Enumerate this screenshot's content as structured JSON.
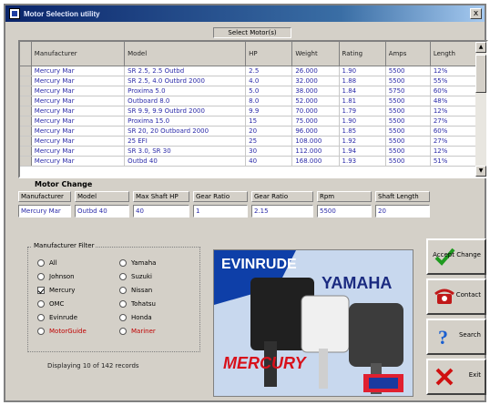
{
  "window": {
    "title": "Motor Selection utility",
    "close_glyph": "x"
  },
  "grid": {
    "caption": "Select Motor(s)",
    "columns": [
      "Manufacturer",
      "Model",
      "HP",
      "Weight",
      "Rating",
      "Amps",
      "Length"
    ],
    "rows": [
      [
        "Mercury Mar",
        "SR 2.5, 2.5 Outbd",
        "2.5",
        "26.000",
        "1.90",
        "5500",
        "12%"
      ],
      [
        "Mercury Mar",
        "SR 2.5, 4.0 Outbrd 2000",
        "4.0",
        "32.000",
        "1.88",
        "5500",
        "55%"
      ],
      [
        "Mercury Mar",
        "Proxima 5.0",
        "5.0",
        "38.000",
        "1.84",
        "5750",
        "60%"
      ],
      [
        "Mercury Mar",
        "Outboard 8.0",
        "8.0",
        "52.000",
        "1.81",
        "5500",
        "48%"
      ],
      [
        "Mercury Mar",
        "SR 9.9, 9.9 Outbrd 2000",
        "9.9",
        "70.000",
        "1.79",
        "5500",
        "12%"
      ],
      [
        "Mercury Mar",
        "Proxima 15.0",
        "15",
        "75.000",
        "1.90",
        "5500",
        "27%"
      ],
      [
        "Mercury Mar",
        "SR 20, 20 Outboard 2000",
        "20",
        "96.000",
        "1.85",
        "5500",
        "60%"
      ],
      [
        "Mercury Mar",
        "25 EFI",
        "25",
        "108.000",
        "1.92",
        "5500",
        "27%"
      ],
      [
        "Mercury Mar",
        "SR 3.0, SR 30",
        "30",
        "112.000",
        "1.94",
        "5500",
        "12%"
      ],
      [
        "Mercury Mar",
        "Outbd 40",
        "40",
        "168.000",
        "1.93",
        "5500",
        "51%"
      ]
    ]
  },
  "motor_change": {
    "label": "Motor Change",
    "headers": [
      "Manufacturer",
      "Model",
      "Max Shaft HP",
      "Gear Ratio",
      "Gear Ratio",
      "Rpm",
      "Shaft Length"
    ],
    "values": [
      "Mercury Mar",
      "Outbd 40",
      "40",
      "1",
      "2.15",
      "5500",
      "20"
    ]
  },
  "manufacturer_group": {
    "legend": "Manufacturer Filter",
    "left_options": [
      {
        "label": "All",
        "type": "radio",
        "checked": false
      },
      {
        "label": "Johnson",
        "type": "radio",
        "checked": false
      },
      {
        "label": "Mercury",
        "type": "checkbox",
        "checked": true
      },
      {
        "label": "OMC",
        "type": "radio",
        "checked": false
      },
      {
        "label": "Evinrude",
        "type": "radio",
        "checked": false
      },
      {
        "label": "MotorGuide",
        "type": "radio",
        "checked": false,
        "red": true
      }
    ],
    "right_options": [
      {
        "label": "Yamaha",
        "type": "radio",
        "checked": false
      },
      {
        "label": "Suzuki",
        "type": "radio",
        "checked": false
      },
      {
        "label": "Nissan",
        "type": "radio",
        "checked": false
      },
      {
        "label": "Tohatsu",
        "type": "radio",
        "checked": false
      },
      {
        "label": "Honda",
        "type": "radio",
        "checked": false
      },
      {
        "label": "Mariner",
        "type": "radio",
        "checked": false,
        "red": true
      }
    ]
  },
  "status": {
    "text": "Displaying 10 of 142 records"
  },
  "photo": {
    "brand_top": "EVINRUDE",
    "brand_right": "YAMAHA",
    "brand_bottom": "MERCURY"
  },
  "buttons": {
    "accept": "Accept Change",
    "contact": "Contact",
    "search": "Search",
    "exit": "Exit"
  },
  "colors": {
    "window_bg": "#d4d0c8",
    "grid_text": "#2a2aa8",
    "title_bar": "#0a246a",
    "red_option": "#c00000"
  }
}
